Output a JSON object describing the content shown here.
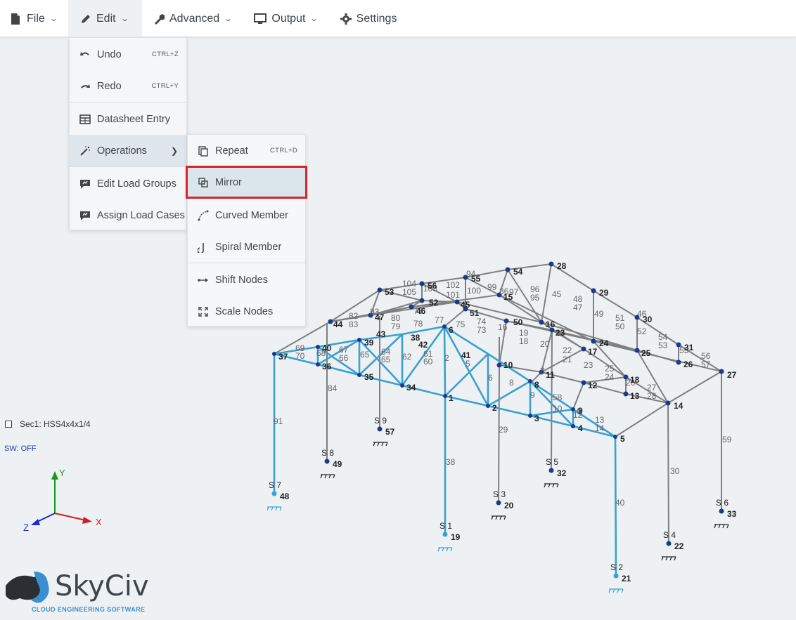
{
  "menubar": {
    "file": "File",
    "edit": "Edit",
    "advanced": "Advanced",
    "output": "Output",
    "settings": "Settings"
  },
  "edit_menu": {
    "undo": "Undo",
    "undo_shortcut": "CTRL+Z",
    "redo": "Redo",
    "redo_shortcut": "CTRL+Y",
    "datasheet": "Datasheet Entry",
    "operations": "Operations",
    "edit_load_groups": "Edit Load Groups",
    "assign_load_cases": "Assign Load Cases"
  },
  "operations_menu": {
    "repeat": "Repeat",
    "repeat_shortcut": "CTRL+D",
    "mirror": "Mirror",
    "curved_member": "Curved Member",
    "spiral_member": "Spiral Member",
    "shift_nodes": "Shift Nodes",
    "scale_nodes": "Scale Nodes"
  },
  "panel": {
    "section": "Sec1: HSS4x4x1/4",
    "self_weight": "SW: OFF"
  },
  "axes": {
    "x": "X",
    "y": "Y",
    "z": "Z"
  },
  "logo": {
    "name": "SkyCiv",
    "tagline": "CLOUD ENGINEERING SOFTWARE"
  },
  "colors": {
    "member_gray": "#7a7a7a",
    "selected_blue": "#3aa0d0",
    "node_navy": "#1b3a8c",
    "highlight_red": "#d9232a"
  },
  "supports": [
    {
      "label": "S 7",
      "node": "48"
    },
    {
      "label": "S 8",
      "node": "49"
    },
    {
      "label": "S 9",
      "node": "57"
    },
    {
      "label": "S 1",
      "node": "19"
    },
    {
      "label": "S 3",
      "node": "20"
    },
    {
      "label": "S 5",
      "node": "32"
    },
    {
      "label": "S 2",
      "node": "21"
    },
    {
      "label": "S 4",
      "node": "22"
    },
    {
      "label": "S 6",
      "node": "33"
    }
  ]
}
